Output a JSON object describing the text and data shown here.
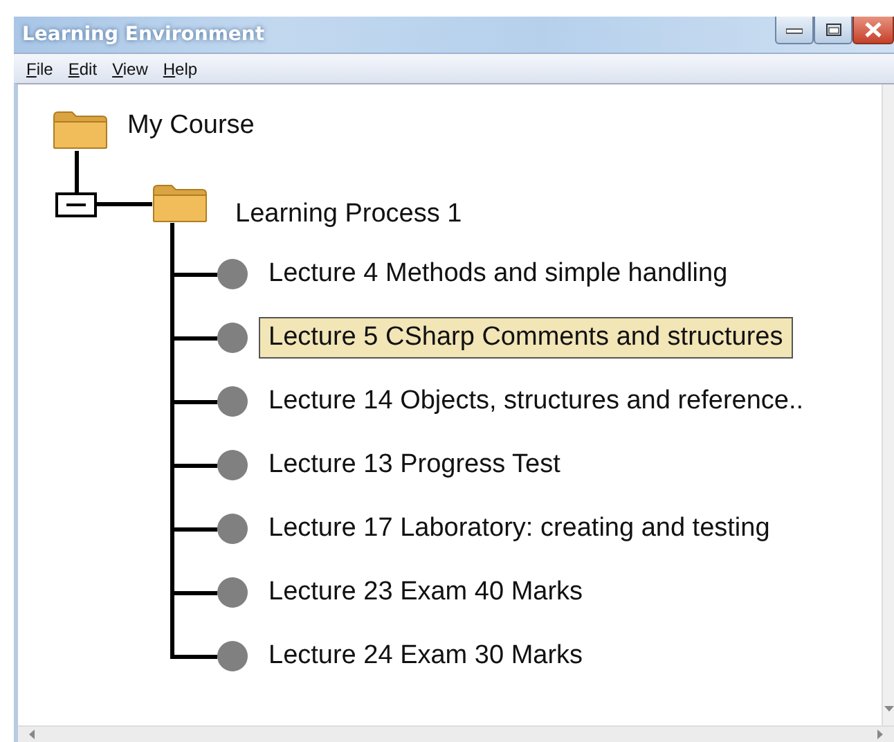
{
  "window": {
    "title": "Learning Environment"
  },
  "menu": [
    "File",
    "Edit",
    "View",
    "Help"
  ],
  "tree": {
    "label": "My Course",
    "kind": "folder",
    "children": [
      {
        "label": "Learning Process 1",
        "kind": "folder",
        "expanded": true,
        "children": [
          {
            "label": "Lecture 4 Methods and simple handling",
            "kind": "item",
            "selected": false
          },
          {
            "label": "Lecture 5 CSharp Comments and structures",
            "kind": "item",
            "selected": true
          },
          {
            "label": "Lecture 14 Objects, structures and reference..",
            "kind": "item",
            "selected": false
          },
          {
            "label": "Lecture 13 Progress Test",
            "kind": "item",
            "selected": false
          },
          {
            "label": "Lecture 17 Laboratory: creating and testing",
            "kind": "item",
            "selected": false
          },
          {
            "label": "Lecture 23 Exam 40 Marks",
            "kind": "item",
            "selected": false
          },
          {
            "label": "Lecture 24 Exam 30 Marks",
            "kind": "item",
            "selected": false
          }
        ]
      }
    ]
  }
}
